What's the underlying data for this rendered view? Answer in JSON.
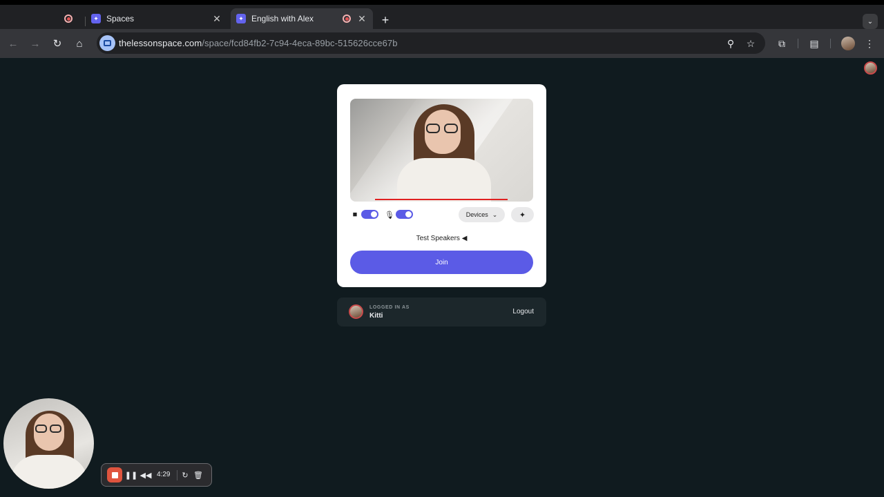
{
  "browser": {
    "tabs": [
      {
        "title": "",
        "recording": true
      },
      {
        "title": "Spaces",
        "close": "✕"
      },
      {
        "title": "English with Alex",
        "close": "✕",
        "active": true
      }
    ],
    "new_tab_icon": "+",
    "tab_search_icon": "⌄",
    "url_host": "thelessonspace.com",
    "url_path": "/space/fcd84fb2-7c94-4eca-89bc-515626cce67b"
  },
  "prejoin": {
    "devices_label": "Devices",
    "test_speakers_label": "Test Speakers",
    "join_label": "Join",
    "camera_on": true,
    "mic_on": true
  },
  "account": {
    "logged_in_label": "LOGGED IN AS",
    "username": "Kitti",
    "logout_label": "Logout"
  },
  "recorder": {
    "elapsed": "4:29"
  },
  "colors": {
    "accent": "#5b5be6",
    "page_bg": "#101b1f",
    "record": "#e0543e"
  }
}
